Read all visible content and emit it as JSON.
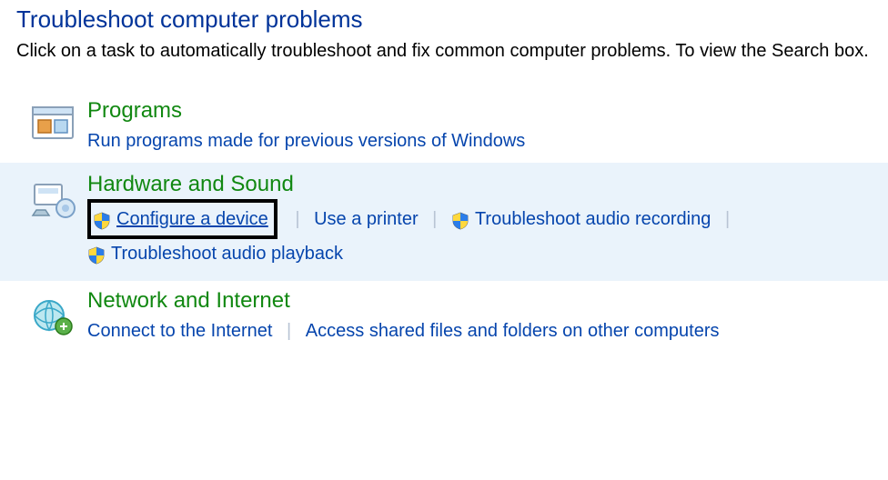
{
  "header": {
    "title": "Troubleshoot computer problems",
    "description": "Click on a task to automatically troubleshoot and fix common computer problems. To view the Search box."
  },
  "categories": {
    "programs": {
      "title": "Programs",
      "link_run_old": "Run programs made for previous versions of Windows"
    },
    "hardware": {
      "title": "Hardware and Sound",
      "link_configure_device": "Configure a device",
      "link_use_printer": "Use a printer",
      "link_audio_recording": "Troubleshoot audio recording",
      "link_audio_playback": "Troubleshoot audio playback"
    },
    "network": {
      "title": "Network and Internet",
      "link_connect": "Connect to the Internet",
      "link_shared": "Access shared files and folders on other computers"
    }
  }
}
